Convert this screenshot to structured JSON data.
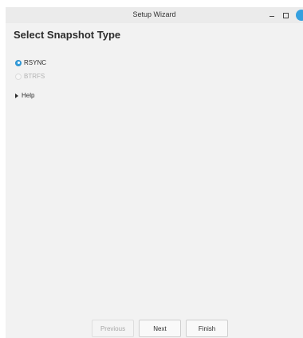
{
  "window": {
    "title": "Setup Wizard",
    "controls": {
      "minimize": "minimize",
      "maximize": "maximize",
      "close": "close"
    }
  },
  "page": {
    "heading": "Select Snapshot Type",
    "options": [
      {
        "label": "RSYNC",
        "checked": true,
        "enabled": true
      },
      {
        "label": "BTRFS",
        "checked": false,
        "enabled": false
      }
    ],
    "help": {
      "label": "Help",
      "expanded": false
    }
  },
  "buttons": {
    "previous": {
      "label": "Previous",
      "enabled": false
    },
    "next": {
      "label": "Next",
      "enabled": true
    },
    "finish": {
      "label": "Finish",
      "enabled": true
    }
  },
  "colors": {
    "accent": "#35a0df",
    "window_bg": "#f2f2f2",
    "disabled_text": "#b2b2b2"
  }
}
